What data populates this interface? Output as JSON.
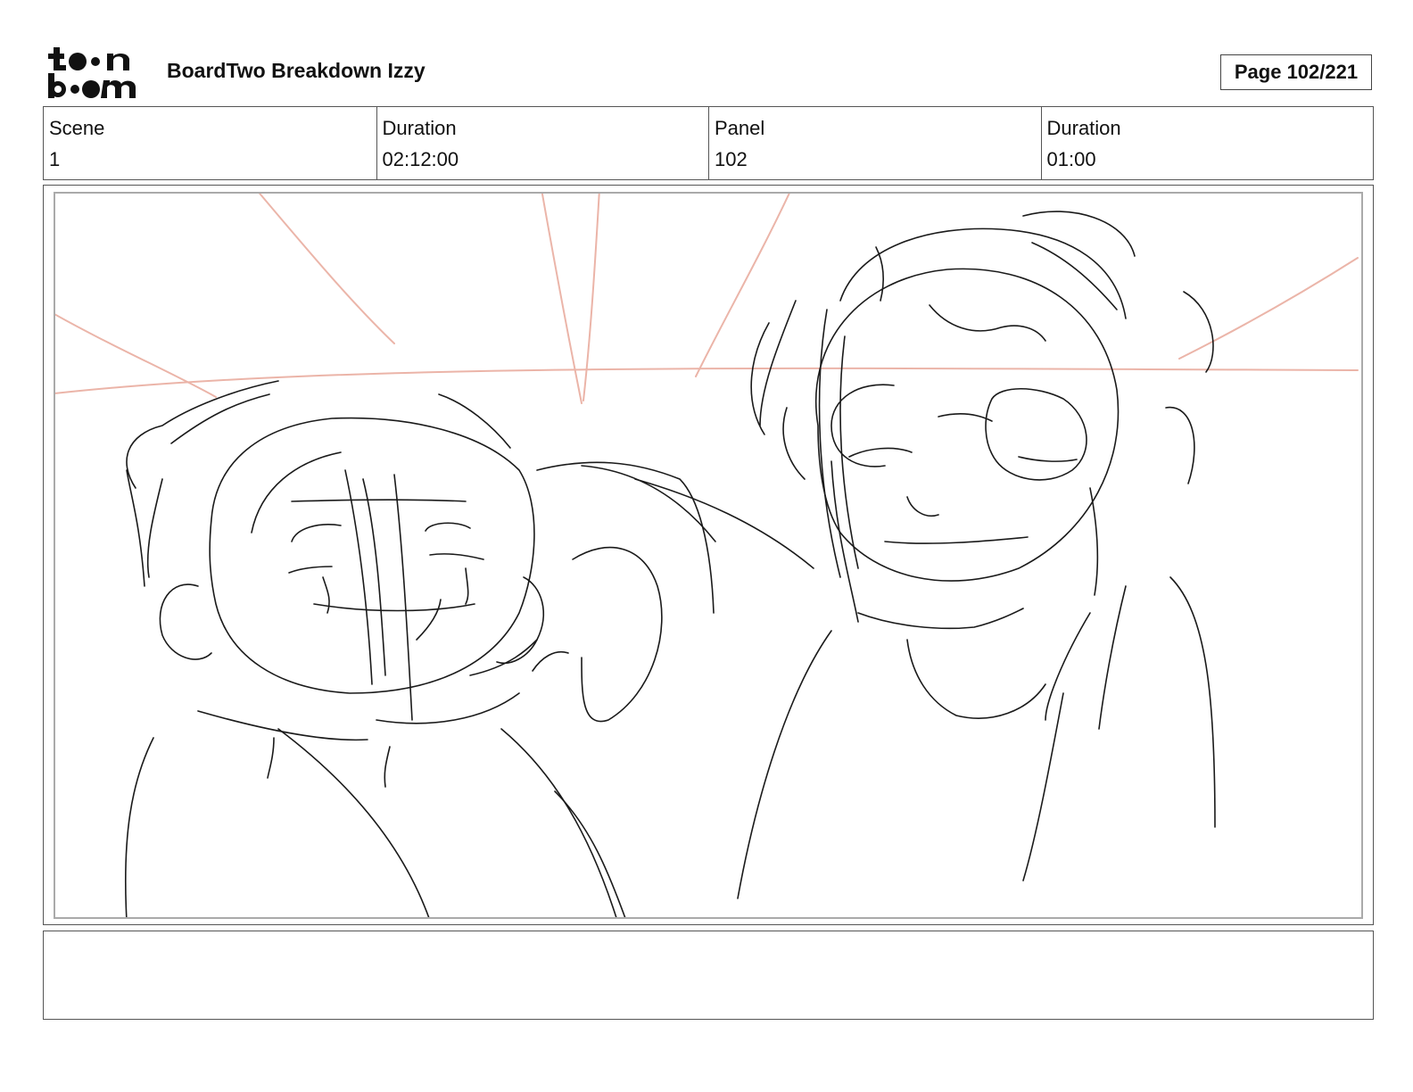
{
  "header": {
    "logo_text": "toon boom",
    "title": "BoardTwo Breakdown Izzy",
    "page_indicator": "Page 102/221"
  },
  "info": {
    "scene_label": "Scene",
    "scene_value": "1",
    "scene_duration_label": "Duration",
    "scene_duration_value": "02:12:00",
    "panel_label": "Panel",
    "panel_value": "102",
    "panel_duration_label": "Duration",
    "panel_duration_value": "01:00"
  },
  "notes": {
    "text": ""
  }
}
